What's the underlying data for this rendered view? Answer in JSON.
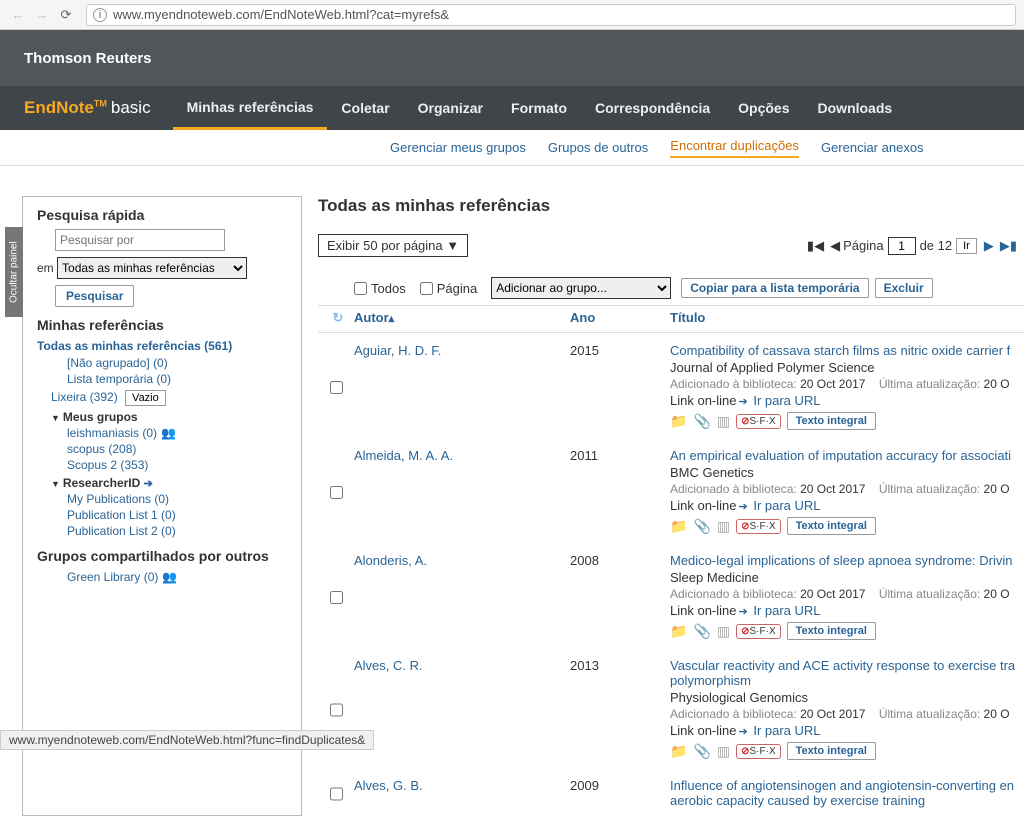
{
  "browser": {
    "url": "www.myendnoteweb.com/EndNoteWeb.html?cat=myrefs&"
  },
  "topbar": {
    "brand": "Thomson Reuters"
  },
  "logo": {
    "endnote": "EndNote",
    "tm": "TM",
    "basic": "basic"
  },
  "nav": {
    "refs": "Minhas referências",
    "coletar": "Coletar",
    "organizar": "Organizar",
    "formato": "Formato",
    "corresp": "Correspondência",
    "opcoes": "Opções",
    "downloads": "Downloads"
  },
  "subnav": {
    "grupos": "Gerenciar meus grupos",
    "outros": "Grupos de outros",
    "dup": "Encontrar duplicações",
    "anexos": "Gerenciar anexos"
  },
  "sidebar": {
    "ocultar": "Ocultar painel",
    "quick": "Pesquisa rápida",
    "placeholder": "Pesquisar por",
    "em": "em",
    "scope": "Todas as minhas referências",
    "pesquisar": "Pesquisar",
    "myrefs": "Minhas referências",
    "allrefs": "Todas as minhas referências (561)",
    "unfiled": "[Não agrupado] (0)",
    "temp": "Lista temporária (0)",
    "lixeira": "Lixeira (392)",
    "vazio": "Vazio",
    "mygroups": "Meus grupos",
    "g1": "leishmaniasis  (0)",
    "g2": "scopus  (208)",
    "g3": "Scopus 2  (353)",
    "rid": "ResearcherID",
    "r1": "My Publications  (0)",
    "r2": "Publication List 1  (0)",
    "r3": "Publication List 2  (0)",
    "shared": "Grupos compartilhados por outros",
    "green": "Green Library  (0)"
  },
  "main": {
    "title": "Todas as minhas referências",
    "perpage": "Exibir 50 por página ▼",
    "page_label": "Página",
    "page_num": "1",
    "page_total": "de 12",
    "ir": "Ir",
    "todos": "Todos",
    "pagina": "Página",
    "addgroup": "Adicionar ao grupo...",
    "copiar": "Copiar para a lista temporária",
    "excluir": "Excluir",
    "col_author": "Autor",
    "col_year": "Ano",
    "col_title": "Título",
    "added_label": "Adicionado à biblioteca:",
    "updated_label": "Última atualização:",
    "linkon": "Link on-line",
    "gotourl": "Ir para URL",
    "texto": "Texto integral"
  },
  "refs": [
    {
      "author": "Aguiar, H. D. F.",
      "year": "2015",
      "title": "Compatibility of cassava starch films as nitric oxide carrier f",
      "journal": "Journal of Applied Polymer Science",
      "added": "20 Oct 2017",
      "updated": "20 O"
    },
    {
      "author": "Almeida, M. A. A.",
      "year": "2011",
      "title": "An empirical evaluation of imputation accuracy for associati",
      "journal": "BMC Genetics",
      "added": "20 Oct 2017",
      "updated": "20 O"
    },
    {
      "author": "Alonderis, A.",
      "year": "2008",
      "title": "Medico-legal implications of sleep apnoea syndrome: Drivin",
      "journal": "Sleep Medicine",
      "added": "20 Oct 2017",
      "updated": "20 O"
    },
    {
      "author": "Alves, C. R.",
      "year": "2013",
      "title": "Vascular reactivity and ACE activity response to exercise tra",
      "title2": "polymorphism",
      "journal": "Physiological Genomics",
      "added": "20 Oct 2017",
      "updated": "20 O"
    },
    {
      "author": "Alves, G. B.",
      "year": "2009",
      "title": "Influence of angiotensinogen and angiotensin-converting en",
      "title2": "aerobic capacity caused by exercise training"
    }
  ],
  "status": "www.myendnoteweb.com/EndNoteWeb.html?func=findDuplicates&"
}
